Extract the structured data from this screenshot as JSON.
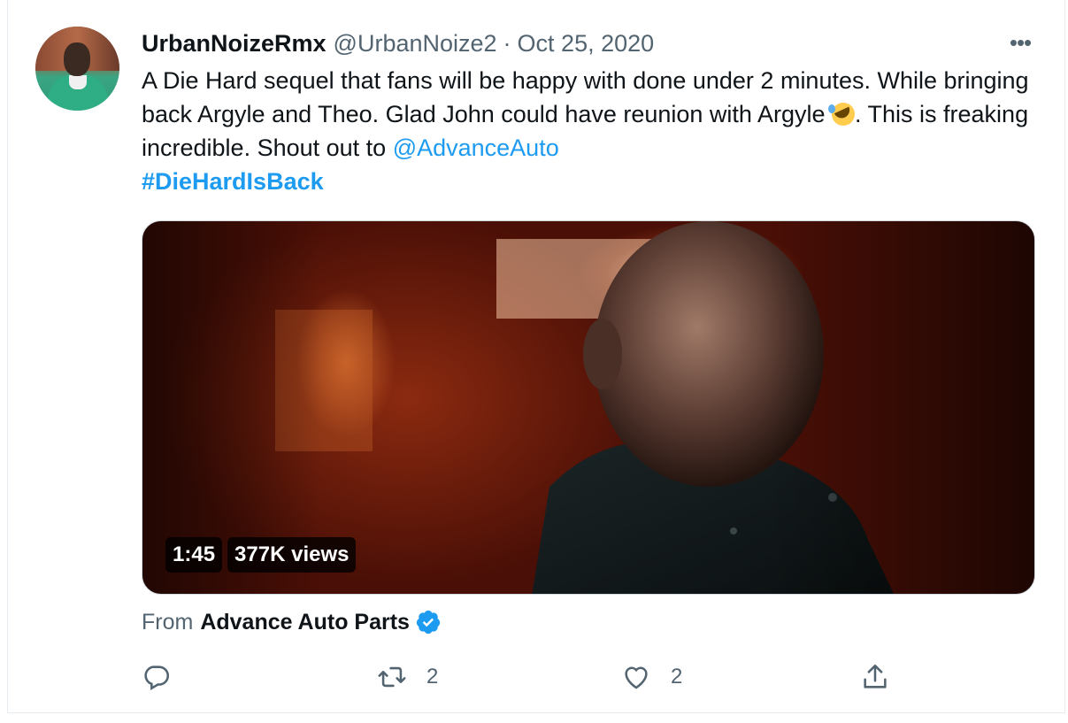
{
  "tweet": {
    "author_name": "UrbanNoizeRmx",
    "handle": "@UrbanNoize2",
    "separator": "·",
    "date": "Oct 25, 2020",
    "more_label": "•••",
    "text_part1": "A Die Hard sequel that fans will be happy with done under 2 minutes. While bringing back Argyle and Theo. Glad John could have reunion with Argyle ",
    "text_part2": ". This is freaking incredible. Shout out to ",
    "mention": "@AdvanceAuto",
    "hashtag": "#DieHardIsBack"
  },
  "media": {
    "duration": "1:45",
    "views": "377K views"
  },
  "source": {
    "label": "From",
    "name": "Advance Auto Parts",
    "verified": true
  },
  "actions": {
    "reply_icon": "reply-icon",
    "retweet_icon": "retweet-icon",
    "retweet_count": "2",
    "like_icon": "heart-icon",
    "like_count": "2",
    "share_icon": "share-icon"
  },
  "colors": {
    "link": "#1d9bf0",
    "secondary": "#536471",
    "text": "#0f1419"
  }
}
